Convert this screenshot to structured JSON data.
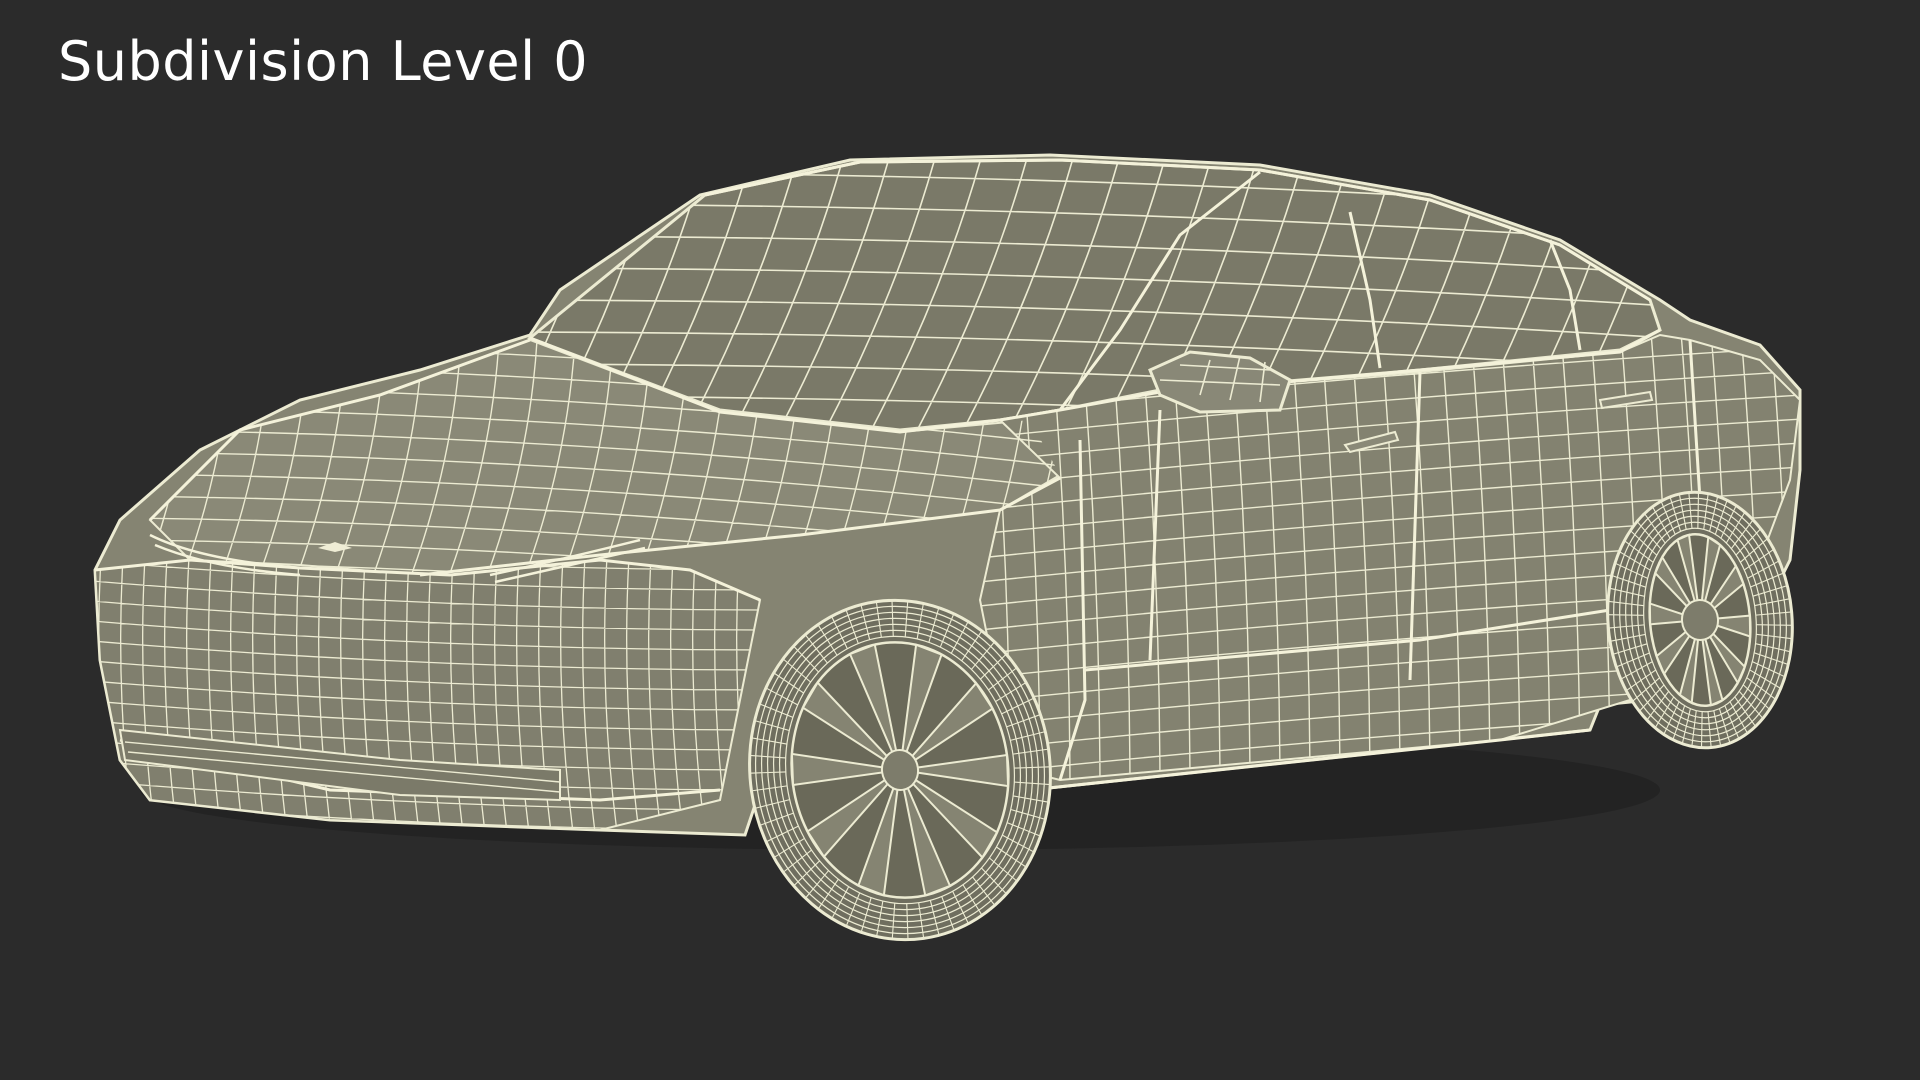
{
  "viewport": {
    "label": "Subdivision Level 0",
    "colors": {
      "background": "#2b2b2b",
      "label": "#ffffff",
      "body_shade": "#858472",
      "body_dark": "#6c6b5b",
      "glass": "#787766",
      "wire": "#ecebd2",
      "tire": "#6f6e5f"
    }
  },
  "model": {
    "subject": "sedan-car-wireframe",
    "subdivision_level": 0
  }
}
